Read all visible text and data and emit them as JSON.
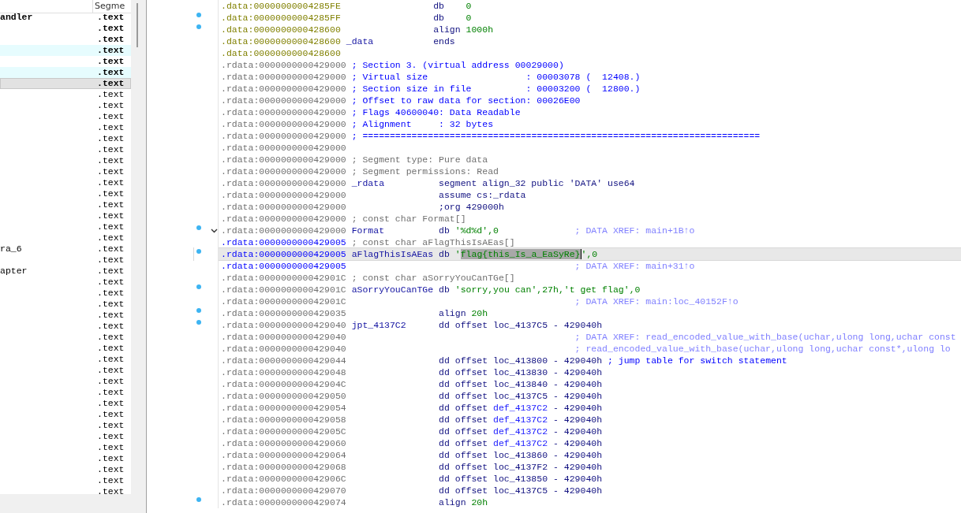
{
  "functions": {
    "column": "Segme",
    "rows": [
      {
        "name": "andler",
        "segment": ".text",
        "bold": true,
        "highlighted": false,
        "selected": false
      },
      {
        "segment": ".text",
        "bold": true,
        "highlighted": false,
        "selected": false
      },
      {
        "segment": ".text",
        "bold": true,
        "highlighted": false,
        "selected": false
      },
      {
        "segment": ".text",
        "bold": true,
        "highlighted": true,
        "selected": false
      },
      {
        "segment": ".text",
        "bold": true,
        "highlighted": false,
        "selected": false
      },
      {
        "segment": ".text",
        "bold": true,
        "highlighted": true,
        "selected": false
      },
      {
        "segment": ".text",
        "bold": true,
        "highlighted": false,
        "selected": true
      },
      {
        "segment": ".text",
        "bold": false,
        "highlighted": false,
        "selected": false
      },
      {
        "segment": ".text",
        "bold": false,
        "highlighted": false,
        "selected": false
      },
      {
        "segment": ".text",
        "bold": false,
        "highlighted": false,
        "selected": false
      },
      {
        "segment": ".text",
        "bold": false,
        "highlighted": false,
        "selected": false
      },
      {
        "segment": ".text",
        "bold": false,
        "highlighted": false,
        "selected": false
      },
      {
        "segment": ".text",
        "bold": false,
        "highlighted": false,
        "selected": false
      },
      {
        "segment": ".text",
        "bold": false,
        "highlighted": false,
        "selected": false
      },
      {
        "segment": ".text",
        "bold": false,
        "highlighted": false,
        "selected": false
      },
      {
        "segment": ".text",
        "bold": false,
        "highlighted": false,
        "selected": false
      },
      {
        "segment": ".text",
        "bold": false,
        "highlighted": false,
        "selected": false
      },
      {
        "segment": ".text",
        "bold": false,
        "highlighted": false,
        "selected": false
      },
      {
        "segment": ".text",
        "bold": false,
        "highlighted": false,
        "selected": false
      },
      {
        "segment": ".text",
        "bold": false,
        "highlighted": false,
        "selected": false
      },
      {
        "segment": ".text",
        "bold": false,
        "highlighted": false,
        "selected": false
      },
      {
        "name": "ra_6",
        "segment": ".text",
        "bold": false,
        "highlighted": false,
        "selected": false
      },
      {
        "segment": ".text",
        "bold": false,
        "highlighted": false,
        "selected": false
      },
      {
        "name": "apter",
        "segment": ".text",
        "bold": false,
        "highlighted": false,
        "selected": false
      },
      {
        "segment": ".text",
        "bold": false,
        "highlighted": false,
        "selected": false
      },
      {
        "segment": ".text",
        "bold": false,
        "highlighted": false,
        "selected": false
      },
      {
        "segment": ".text",
        "bold": false,
        "highlighted": false,
        "selected": false
      },
      {
        "segment": ".text",
        "bold": false,
        "highlighted": false,
        "selected": false
      },
      {
        "segment": ".text",
        "bold": false,
        "highlighted": false,
        "selected": false
      },
      {
        "segment": ".text",
        "bold": false,
        "highlighted": false,
        "selected": false
      },
      {
        "segment": ".text",
        "bold": false,
        "highlighted": false,
        "selected": false
      },
      {
        "segment": ".text",
        "bold": false,
        "highlighted": false,
        "selected": false
      },
      {
        "segment": ".text",
        "bold": false,
        "highlighted": false,
        "selected": false
      },
      {
        "segment": ".text",
        "bold": false,
        "highlighted": false,
        "selected": false
      },
      {
        "segment": ".text",
        "bold": false,
        "highlighted": false,
        "selected": false
      },
      {
        "segment": ".text",
        "bold": false,
        "highlighted": false,
        "selected": false
      },
      {
        "segment": ".text",
        "bold": false,
        "highlighted": false,
        "selected": false
      },
      {
        "segment": ".text",
        "bold": false,
        "highlighted": false,
        "selected": false
      },
      {
        "segment": ".text",
        "bold": false,
        "highlighted": false,
        "selected": false
      },
      {
        "segment": ".text",
        "bold": false,
        "highlighted": false,
        "selected": false
      },
      {
        "segment": ".text",
        "bold": false,
        "highlighted": false,
        "selected": false
      },
      {
        "segment": ".text",
        "bold": false,
        "highlighted": false,
        "selected": false
      },
      {
        "segment": ".text",
        "bold": false,
        "highlighted": false,
        "selected": false
      },
      {
        "segment": ".text",
        "bold": false,
        "highlighted": false,
        "selected": false
      }
    ]
  },
  "listing": {
    "lines": [
      {
        "addr": ".data:00000000004285FE",
        "color": "#808000",
        "marker": false,
        "current": false,
        "instr": [
          {
            "kind": "op",
            "text": "db    "
          },
          {
            "kind": "num",
            "text": "0"
          }
        ]
      },
      {
        "addr": ".data:00000000004285FF",
        "color": "#808000",
        "marker": true,
        "current": false,
        "instr": [
          {
            "kind": "op",
            "text": "db    "
          },
          {
            "kind": "num",
            "text": "0"
          }
        ]
      },
      {
        "addr": ".data:0000000000428600",
        "color": "#808000",
        "marker": true,
        "current": false,
        "instr": [
          {
            "kind": "op",
            "text": "align "
          },
          {
            "kind": "num",
            "text": "1000h"
          }
        ]
      },
      {
        "addr": ".data:0000000000428600",
        "color": "#808000",
        "marker": false,
        "current": false,
        "label": "_data",
        "instr": [
          {
            "kind": "op",
            "text": "ends"
          }
        ]
      },
      {
        "addr": ".data:0000000000428600",
        "color": "#808000",
        "marker": false,
        "current": false
      },
      {
        "addr": ".rdata:0000000000429000",
        "color": "#707070",
        "marker": false,
        "current": false,
        "note": {
          "kind": "header",
          "text": "; Section 3. (virtual address 00029000)"
        }
      },
      {
        "addr": ".rdata:0000000000429000",
        "color": "#707070",
        "marker": false,
        "current": false,
        "note": {
          "kind": "header",
          "text": "; Virtual size                  : 00003078 (  12408.)"
        }
      },
      {
        "addr": ".rdata:0000000000429000",
        "color": "#707070",
        "marker": false,
        "current": false,
        "note": {
          "kind": "header",
          "text": "; Section size in file          : 00003200 (  12800.)"
        }
      },
      {
        "addr": ".rdata:0000000000429000",
        "color": "#707070",
        "marker": false,
        "current": false,
        "note": {
          "kind": "header",
          "text": "; Offset to raw data for section: 00026E00"
        }
      },
      {
        "addr": ".rdata:0000000000429000",
        "color": "#707070",
        "marker": false,
        "current": false,
        "note": {
          "kind": "header",
          "text": "; Flags 40600040: Data Readable"
        }
      },
      {
        "addr": ".rdata:0000000000429000",
        "color": "#707070",
        "marker": false,
        "current": false,
        "note": {
          "kind": "header",
          "text": "; Alignment     : 32 bytes"
        }
      },
      {
        "addr": ".rdata:0000000000429000",
        "color": "#707070",
        "marker": false,
        "current": false,
        "note": {
          "kind": "header",
          "text": "; ========================================================================="
        }
      },
      {
        "addr": ".rdata:0000000000429000",
        "color": "#707070",
        "marker": false,
        "current": false
      },
      {
        "addr": ".rdata:0000000000429000",
        "color": "#707070",
        "marker": false,
        "current": false,
        "note": {
          "kind": "plain",
          "text": "; Segment type: Pure data"
        }
      },
      {
        "addr": ".rdata:0000000000429000",
        "color": "#707070",
        "marker": false,
        "current": false,
        "note": {
          "kind": "plain",
          "text": "; Segment permissions: Read"
        }
      },
      {
        "addr": ".rdata:0000000000429000",
        "color": "#707070",
        "marker": false,
        "current": false,
        "label": "_rdata",
        "instr": [
          {
            "kind": "op",
            "text": "segment align_32 public "
          },
          {
            "kind": "sym",
            "text": "'DATA'"
          },
          {
            "kind": "op",
            "text": " use64"
          }
        ]
      },
      {
        "addr": ".rdata:0000000000429000",
        "color": "#707070",
        "marker": false,
        "current": false,
        "instr": [
          {
            "kind": "op",
            "text": "assume cs:_rdata"
          }
        ]
      },
      {
        "addr": ".rdata:0000000000429000",
        "color": "#707070",
        "marker": false,
        "current": false,
        "instr": [
          {
            "kind": "op",
            "text": ";org 429000h"
          }
        ]
      },
      {
        "addr": ".rdata:0000000000429000",
        "color": "#707070",
        "marker": false,
        "current": false,
        "note": {
          "kind": "plain",
          "text": "; const char Format[]"
        }
      },
      {
        "addr": ".rdata:0000000000429000",
        "color": "#707070",
        "marker": true,
        "collapsible": true,
        "current": false,
        "label": "Format",
        "instr": [
          {
            "kind": "op",
            "text": "db "
          },
          {
            "kind": "str",
            "text": "'%d%d'"
          },
          {
            "kind": "num",
            "text": ",0"
          }
        ],
        "comment": {
          "kind": "xref",
          "text": "; DATA XREF: main+1B↑o"
        }
      },
      {
        "addr": ".rdata:0000000000429005",
        "color": "#0000ff",
        "marker": false,
        "current": false,
        "note": {
          "kind": "plain",
          "text": "; const char aFlagThisIsAEas[]"
        }
      },
      {
        "addr": ".rdata:0000000000429005",
        "color": "#0000ff",
        "marker": true,
        "current": true,
        "label": "aFlagThisIsAEas",
        "instr": [
          {
            "kind": "op",
            "text": "db "
          },
          {
            "kind": "str",
            "text": "'"
          },
          {
            "kind": "selection",
            "text": "flag{this_Is_a_EaSyRe}"
          },
          {
            "kind": "str",
            "text": "'"
          },
          {
            "kind": "num",
            "text": ",0"
          }
        ]
      },
      {
        "addr": ".rdata:0000000000429005",
        "color": "#0000ff",
        "marker": false,
        "current": false,
        "comment": {
          "kind": "xref",
          "text": "; DATA XREF: main+31↑o"
        }
      },
      {
        "addr": ".rdata:000000000042901C",
        "color": "#707070",
        "marker": false,
        "current": false,
        "note": {
          "kind": "plain",
          "text": "; const char aSorryYouCanTGe[]"
        }
      },
      {
        "addr": ".rdata:000000000042901C",
        "color": "#707070",
        "marker": true,
        "current": false,
        "label": "aSorryYouCanTGe",
        "instr": [
          {
            "kind": "op",
            "text": "db "
          },
          {
            "kind": "str",
            "text": "'sorry,you can'"
          },
          {
            "kind": "num",
            "text": ",27h,"
          },
          {
            "kind": "str",
            "text": "'t get flag'"
          },
          {
            "kind": "num",
            "text": ",0"
          }
        ]
      },
      {
        "addr": ".rdata:000000000042901C",
        "color": "#707070",
        "marker": false,
        "current": false,
        "comment": {
          "kind": "xref",
          "text": "; DATA XREF: main:loc_40152F↑o"
        }
      },
      {
        "addr": ".rdata:0000000000429035",
        "color": "#707070",
        "marker": true,
        "current": false,
        "instr": [
          {
            "kind": "op",
            "text": "align "
          },
          {
            "kind": "num",
            "text": "20h"
          }
        ]
      },
      {
        "addr": ".rdata:0000000000429040",
        "color": "#707070",
        "marker": true,
        "current": false,
        "label": "jpt_4137C2",
        "instr": [
          {
            "kind": "op",
            "text": "dd offset "
          },
          {
            "kind": "sym",
            "text": "loc_4137C5"
          },
          {
            "kind": "op",
            "text": " - 429040h"
          }
        ]
      },
      {
        "addr": ".rdata:0000000000429040",
        "color": "#707070",
        "marker": false,
        "current": false,
        "comment": {
          "kind": "xref",
          "text": "; DATA XREF: read_encoded_value_with_base(uchar,ulong long,uchar const"
        }
      },
      {
        "addr": ".rdata:0000000000429040",
        "color": "#707070",
        "marker": false,
        "current": false,
        "comment": {
          "kind": "xref",
          "text": "; read_encoded_value_with_base(uchar,ulong long,uchar const*,ulong lo"
        }
      },
      {
        "addr": ".rdata:0000000000429044",
        "color": "#707070",
        "marker": false,
        "current": false,
        "instr": [
          {
            "kind": "op",
            "text": "dd offset "
          },
          {
            "kind": "sym",
            "text": "loc_413800"
          },
          {
            "kind": "op",
            "text": " - 429040h"
          }
        ],
        "comment": {
          "kind": "note",
          "text": "; jump table for switch statement"
        }
      },
      {
        "addr": ".rdata:0000000000429048",
        "color": "#707070",
        "marker": false,
        "current": false,
        "instr": [
          {
            "kind": "op",
            "text": "dd offset "
          },
          {
            "kind": "sym",
            "text": "loc_413830"
          },
          {
            "kind": "op",
            "text": " - 429040h"
          }
        ]
      },
      {
        "addr": ".rdata:000000000042904C",
        "color": "#707070",
        "marker": false,
        "current": false,
        "instr": [
          {
            "kind": "op",
            "text": "dd offset "
          },
          {
            "kind": "sym",
            "text": "loc_413840"
          },
          {
            "kind": "op",
            "text": " - 429040h"
          }
        ]
      },
      {
        "addr": ".rdata:0000000000429050",
        "color": "#707070",
        "marker": false,
        "current": false,
        "instr": [
          {
            "kind": "op",
            "text": "dd offset "
          },
          {
            "kind": "sym",
            "text": "loc_4137C5"
          },
          {
            "kind": "op",
            "text": " - 429040h"
          }
        ]
      },
      {
        "addr": ".rdata:0000000000429054",
        "color": "#707070",
        "marker": false,
        "current": false,
        "instr": [
          {
            "kind": "op",
            "text": "dd offset "
          },
          {
            "kind": "def",
            "text": "def_4137C2"
          },
          {
            "kind": "op",
            "text": " - 429040h"
          }
        ]
      },
      {
        "addr": ".rdata:0000000000429058",
        "color": "#707070",
        "marker": false,
        "current": false,
        "instr": [
          {
            "kind": "op",
            "text": "dd offset "
          },
          {
            "kind": "def",
            "text": "def_4137C2"
          },
          {
            "kind": "op",
            "text": " - 429040h"
          }
        ]
      },
      {
        "addr": ".rdata:000000000042905C",
        "color": "#707070",
        "marker": false,
        "current": false,
        "instr": [
          {
            "kind": "op",
            "text": "dd offset "
          },
          {
            "kind": "def",
            "text": "def_4137C2"
          },
          {
            "kind": "op",
            "text": " - 429040h"
          }
        ]
      },
      {
        "addr": ".rdata:0000000000429060",
        "color": "#707070",
        "marker": false,
        "current": false,
        "instr": [
          {
            "kind": "op",
            "text": "dd offset "
          },
          {
            "kind": "def",
            "text": "def_4137C2"
          },
          {
            "kind": "op",
            "text": " - 429040h"
          }
        ]
      },
      {
        "addr": ".rdata:0000000000429064",
        "color": "#707070",
        "marker": false,
        "current": false,
        "instr": [
          {
            "kind": "op",
            "text": "dd offset "
          },
          {
            "kind": "sym",
            "text": "loc_413860"
          },
          {
            "kind": "op",
            "text": " - 429040h"
          }
        ]
      },
      {
        "addr": ".rdata:0000000000429068",
        "color": "#707070",
        "marker": false,
        "current": false,
        "instr": [
          {
            "kind": "op",
            "text": "dd offset "
          },
          {
            "kind": "sym",
            "text": "loc_4137F2"
          },
          {
            "kind": "op",
            "text": " - 429040h"
          }
        ]
      },
      {
        "addr": ".rdata:000000000042906C",
        "color": "#707070",
        "marker": false,
        "current": false,
        "instr": [
          {
            "kind": "op",
            "text": "dd offset "
          },
          {
            "kind": "sym",
            "text": "loc_413850"
          },
          {
            "kind": "op",
            "text": " - 429040h"
          }
        ]
      },
      {
        "addr": ".rdata:0000000000429070",
        "color": "#707070",
        "marker": false,
        "current": false,
        "instr": [
          {
            "kind": "op",
            "text": "dd offset "
          },
          {
            "kind": "sym",
            "text": "loc_4137C5"
          },
          {
            "kind": "op",
            "text": " - 429040h"
          }
        ]
      },
      {
        "addr": ".rdata:0000000000429074",
        "color": "#707070",
        "marker": true,
        "current": false,
        "instr": [
          {
            "kind": "op",
            "text": "align "
          },
          {
            "kind": "num",
            "text": "20h"
          }
        ]
      }
    ]
  }
}
